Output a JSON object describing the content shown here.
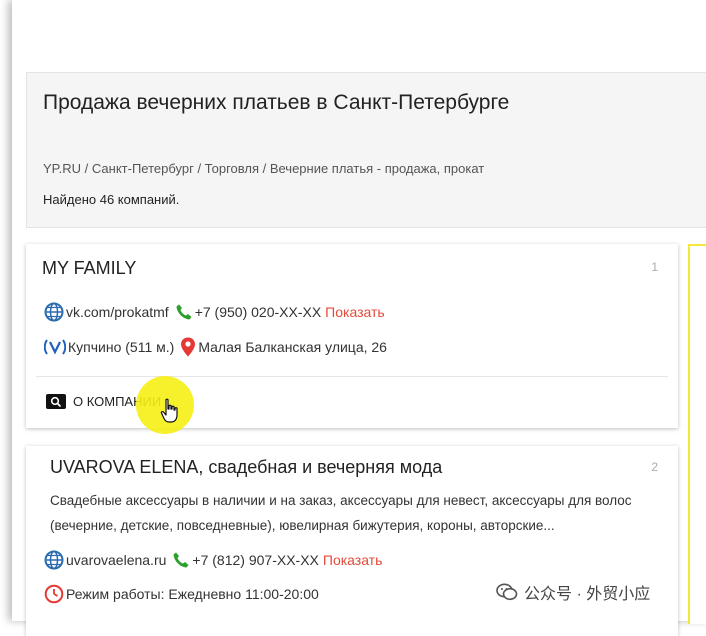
{
  "header": {
    "title": "Продажа вечерних платьев в Санкт-Петербурге",
    "breadcrumb": "YP.RU / Санкт-Петербург / Торговля / Вечерние платья - продажа, прокат",
    "found": "Найдено 46 компаний."
  },
  "companies": [
    {
      "index": "1",
      "name": "MY FAMILY",
      "website": "vk.com/prokatmf",
      "phone": "+7 (950) 020-XX-XX",
      "show_label": "Показать",
      "metro": "Купчино (511 м.)",
      "address": "Малая Балканская улица, 26",
      "about_label": "О КОМПАНИИ"
    },
    {
      "index": "2",
      "name": "UVAROVA ELENA, свадебная и вечерняя мода",
      "description": "Свадебные аксессуары в наличии и на заказ, аксессуары для невест, аксессуары для волос (вечерние, детские, повседневные), ювелирная бижутерия, короны, авторские...",
      "website": "uvarovaelena.ru",
      "phone": "+7 (812) 907-XX-XX",
      "show_label": "Показать",
      "hours": "Режим работы: Ежедневно 11:00-20:00"
    }
  ],
  "watermark": "公众号 · 外贸小应",
  "colors": {
    "link_red": "#e44b3b",
    "phone_green": "#2ca02c",
    "globe_blue": "#2b6cb0",
    "metro_blue": "#1f5fbf",
    "pin_red": "#e53935",
    "highlight_yellow": "#f5f014"
  }
}
